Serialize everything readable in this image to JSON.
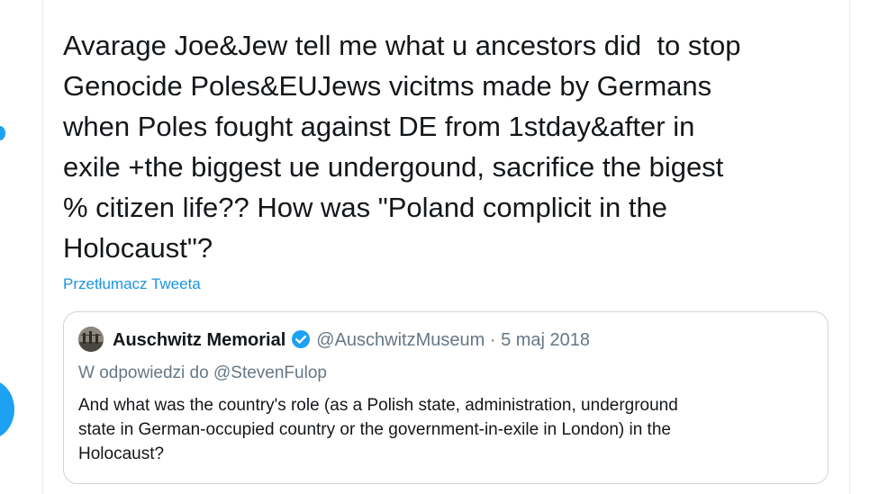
{
  "tweet": {
    "text": "Avarage Joe&Jew tell me what u ancestors did  to stop\nGenocide Poles&EUJews vicitms made by Germans\nwhen Poles fought against DE from 1stday&after in\nexile +the biggest ue undergound, sacrifice the bigest\n% citizen life?? How was \"Poland complicit in the\nHolocaust\"?",
    "translate_label": "Przetłumacz Tweeta"
  },
  "quoted_tweet": {
    "author_name": "Auschwitz Memorial",
    "author_handle": "@AuschwitzMuseum",
    "separator": "·",
    "date": "5 maj 2018",
    "reply_prefix": "W odpowiedzi do",
    "reply_to_handle": "@StevenFulop",
    "text": "And what was the country's role (as a Polish state, administration, underground\nstate in German-occupied country or the government-in-exile in London) in the\nHolocaust?"
  },
  "icons": {
    "verified": "verified-badge-icon",
    "avatar": "avatar"
  },
  "colors": {
    "accent": "#1da1f2",
    "link": "#1b95e0",
    "text_primary": "#14171a",
    "text_secondary": "#657786",
    "border": "#ccd6dd"
  }
}
